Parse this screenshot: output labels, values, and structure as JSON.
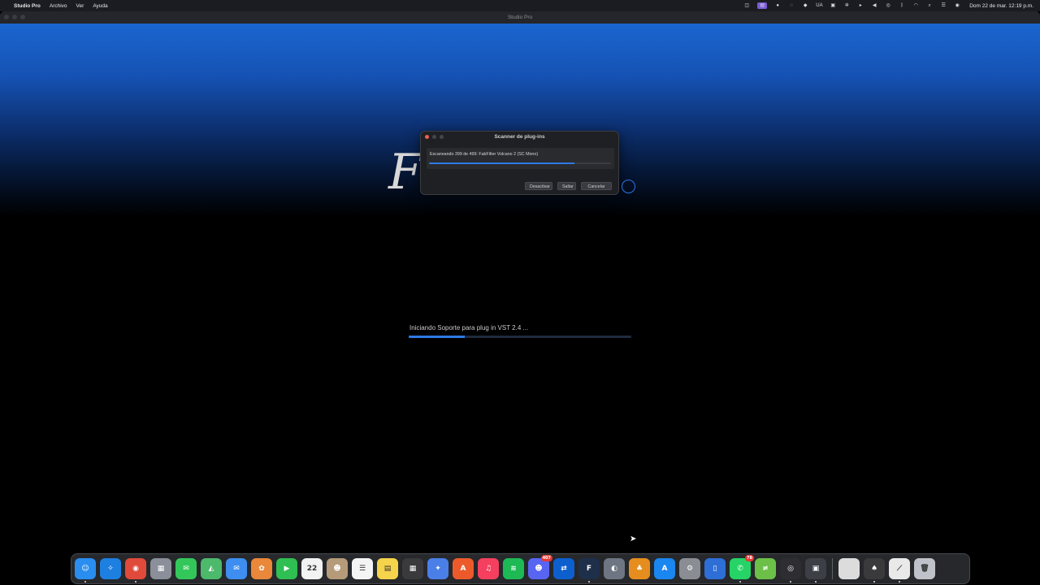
{
  "menubar": {
    "apple_icon": "apple-logo-icon",
    "app_name": "Studio Pro",
    "items": [
      "Archivo",
      "Ver",
      "Ayuda"
    ],
    "status_icons": [
      {
        "name": "screen-record-icon",
        "glyph": "◫"
      },
      {
        "name": "tool-active-icon",
        "glyph": "▤",
        "active": true
      },
      {
        "name": "record-dot-icon",
        "glyph": "●"
      },
      {
        "name": "sync-icon",
        "glyph": "◌"
      },
      {
        "name": "eye-icon",
        "glyph": "◆"
      },
      {
        "name": "input-source-icon",
        "glyph": "UA"
      },
      {
        "name": "dictionary-icon",
        "glyph": "▣"
      },
      {
        "name": "settings-gear-icon",
        "glyph": "✲"
      },
      {
        "name": "play-icon",
        "glyph": "▸"
      },
      {
        "name": "volume-icon",
        "glyph": "◀"
      },
      {
        "name": "airdrop-icon",
        "glyph": "◎"
      },
      {
        "name": "bluetooth-icon",
        "glyph": "ᛒ"
      },
      {
        "name": "wifi-icon",
        "glyph": "◠"
      },
      {
        "name": "search-icon",
        "glyph": "⌕"
      },
      {
        "name": "control-center-icon",
        "glyph": "☰"
      },
      {
        "name": "siri-icon",
        "glyph": "◉"
      }
    ],
    "clock": "Dom 22 de mar.  12:19 p.m."
  },
  "window": {
    "title": "Studio Pro"
  },
  "splash": {
    "logo_glyph": "F"
  },
  "scanner_dialog": {
    "title": "Scanner de plug-ins",
    "status_text": "Escaneando 399 de 499: FabFilter Volcano 2 (SC Mono)",
    "progress": 0.8,
    "buttons": {
      "disable": "Desactivar",
      "skip": "Saltar",
      "cancel": "Cancelar"
    }
  },
  "loading": {
    "text": "Iniciando Soporte para plug in VST 2.4 ...",
    "progress": 0.25
  },
  "dock": {
    "apps": [
      {
        "name": "finder-icon",
        "glyph": "☺",
        "color": "#2a8df0",
        "running": true
      },
      {
        "name": "safari-icon",
        "glyph": "✧",
        "color": "#1d7fe0"
      },
      {
        "name": "chrome-icon",
        "glyph": "◉",
        "color": "#e04a3b",
        "running": true
      },
      {
        "name": "launchpad-icon",
        "glyph": "▦",
        "color": "#8a8f9a"
      },
      {
        "name": "messages-icon",
        "glyph": "✉",
        "color": "#33c75a"
      },
      {
        "name": "maps-icon",
        "glyph": "◭",
        "color": "#4cb96b"
      },
      {
        "name": "mail-icon",
        "glyph": "✉",
        "color": "#3d8ef0"
      },
      {
        "name": "photos-icon",
        "glyph": "✿",
        "color": "#e9873a"
      },
      {
        "name": "facetime-icon",
        "glyph": "▶",
        "color": "#2fbf52"
      },
      {
        "name": "calendar-icon",
        "glyph": "22",
        "color": "#f2f2f2"
      },
      {
        "name": "contacts-icon",
        "glyph": "☻",
        "color": "#b59b79"
      },
      {
        "name": "reminders-icon",
        "glyph": "☰",
        "color": "#f4f4f4"
      },
      {
        "name": "notes-icon",
        "glyph": "▤",
        "color": "#f5d34a"
      },
      {
        "name": "calculator-icon",
        "glyph": "▦",
        "color": "#3a3a3c"
      },
      {
        "name": "gemini-icon",
        "glyph": "✦",
        "color": "#4a7fe8"
      },
      {
        "name": "auro-icon",
        "glyph": "A",
        "color": "#ec5a2c"
      },
      {
        "name": "music-icon",
        "glyph": "♫",
        "color": "#f43f5e"
      },
      {
        "name": "spotify-icon",
        "glyph": "≋",
        "color": "#1db954"
      },
      {
        "name": "discord-icon",
        "glyph": "☻",
        "color": "#5865f2",
        "badge": "407"
      },
      {
        "name": "teamviewer-icon",
        "glyph": "⇄",
        "color": "#0e5fce"
      },
      {
        "name": "fender-studio-icon",
        "glyph": "F",
        "color": "#1e2f4a",
        "running": true
      },
      {
        "name": "davinci-resolve-icon",
        "glyph": "◐",
        "color": "#6d7682"
      },
      {
        "name": "fl-studio-icon",
        "glyph": "♣",
        "color": "#e58d1f"
      },
      {
        "name": "app-store-icon",
        "glyph": "A",
        "color": "#1a86f0"
      },
      {
        "name": "system-settings-icon",
        "glyph": "⚙",
        "color": "#8a8d93"
      },
      {
        "name": "document-app-icon",
        "glyph": "▯",
        "color": "#2d6fd6"
      },
      {
        "name": "whatsapp-icon",
        "glyph": "✆",
        "color": "#25d366",
        "badge": "78",
        "running": true
      },
      {
        "name": "vector-tool-icon",
        "glyph": "≠",
        "color": "#6cc048"
      },
      {
        "name": "obs-icon",
        "glyph": "◎",
        "color": "#2e2e32",
        "running": true
      },
      {
        "name": "hardware-app-icon",
        "glyph": "▣",
        "color": "#3c3f45",
        "running": true
      }
    ],
    "extras": [
      {
        "name": "blank-window-icon",
        "glyph": "",
        "color": "#dcdcdc"
      },
      {
        "name": "folder-stack-icon",
        "glyph": "♠",
        "color": "#3a3a3c",
        "running": true
      },
      {
        "name": "studio-pro-icon",
        "glyph": "⟋",
        "color": "#e9e9e9",
        "running": true
      },
      {
        "name": "trash-icon",
        "glyph": "🗑",
        "color": "#bfc3c9"
      }
    ]
  }
}
